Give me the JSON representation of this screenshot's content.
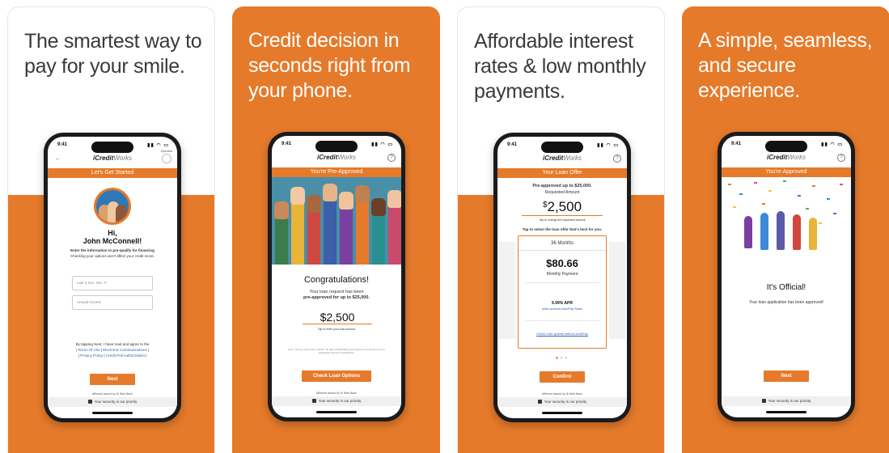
{
  "panels": [
    {
      "headline": "The smartest way to pay for your smile.",
      "screen": {
        "time": "9:41",
        "logo_bold": "iCredit",
        "logo_light": "Works",
        "language": "Spanish",
        "strip_title": "Let's Get Started",
        "greeting": "Hi,",
        "name": "John McConnell!",
        "instruction": "Enter the information to pre-qualify for financing",
        "subinstruction": "Checking your options won't affect your credit score.",
        "ssn_placeholder": "Last 4 Soc. Sec. #",
        "income_placeholder": "Annual Income",
        "terms_intro": "By tapping Next, I have read and agree to the",
        "terms_link1": "Terms Of Use",
        "terms_link2": "Electronic Communications",
        "terms_link3": "Privacy Policy",
        "terms_link4": "Credit Pull Authorization",
        "button": "Next",
        "trust": "Affirmed issued by ⚙ Web Bank",
        "footer": "Your security is our priority"
      }
    },
    {
      "headline": "Credit decision in seconds right from your phone.",
      "screen": {
        "time": "9:41",
        "logo_bold": "iCredit",
        "logo_light": "Works",
        "strip_title": "You're Pre-Approved",
        "congrats": "Congratulations!",
        "message": "Your loan request has been",
        "message_bold": "pre-approved for up to $25,000.",
        "amount": "$2,500",
        "amount_hint": "Tap to enter your loan amount",
        "note": "Note: This pre-approval is valid for 30 days (11/30/2024) and subject to completion of your application through iCreditWorks.",
        "button": "Check Loan Options",
        "trust": "Affirmed issued by ⚙ Web Bank",
        "footer": "Your security is our priority"
      }
    },
    {
      "headline": "Affordable interest rates & low monthly payments.",
      "screen": {
        "time": "9:41",
        "logo_bold": "iCredit",
        "logo_light": "Works",
        "strip_title": "Your Loan Offer",
        "preapproved": "Pre-approved up to $25,000.",
        "requested_label": "Requested Amount",
        "amount_symbol": "$",
        "amount": "2,500",
        "amount_hint": "Tap to change the requested amount",
        "select_prompt": "Tap to select the loan offer that's best for you.",
        "term": "36 Months",
        "payment": "$80.66",
        "payment_label": "Monthly Payment",
        "apr": "9.99% APR",
        "apr_note": "(with optional AutoPay Rate)",
        "autopay_link": "Check loan options without AutoPay",
        "button": "Confirm",
        "trust": "Affirmed issued by ⚙ Web Bank",
        "footer": "Your security is our priority"
      }
    },
    {
      "headline": "A simple, seamless, and secure experience.",
      "screen": {
        "time": "9:41",
        "logo_bold": "iCredit",
        "logo_light": "Works",
        "strip_title": "You're Approved",
        "official": "It's Official!",
        "message": "Your loan application has been approved!",
        "button": "Next",
        "footer": "Your security is our priority"
      }
    }
  ],
  "colors": {
    "accent": "#e57a2a",
    "text": "#3a3a3a"
  }
}
